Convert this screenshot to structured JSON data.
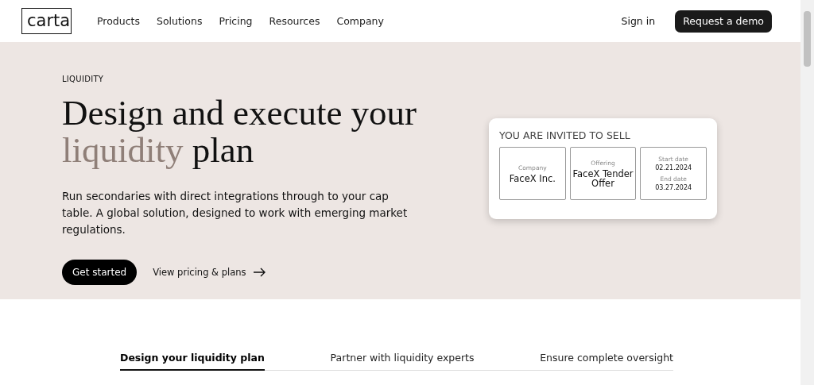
{
  "header": {
    "logo": "carta",
    "nav": [
      "Products",
      "Solutions",
      "Pricing",
      "Resources",
      "Company"
    ],
    "sign_in": "Sign in",
    "cta": "Request a demo"
  },
  "hero": {
    "eyebrow": "LIQUIDITY",
    "headline_before": "Design and execute your",
    "headline_accent": "liquidity",
    "headline_after": "plan",
    "body": "Run secondaries with direct integrations through to your cap table. A global solution, designed to work with emerging market regulations.",
    "primary": "Get started",
    "secondary": "View pricing & plans"
  },
  "card": {
    "title": "YOU ARE INVITED TO SELL",
    "company_label": "Company",
    "company": "FaceX Inc.",
    "offering_label": "Offering",
    "offering": "FaceX Tender Offer",
    "start_label": "Start date",
    "start": "02.21.2024",
    "end_label": "End date",
    "end": "03.27.2024"
  },
  "tabs": [
    {
      "label": "Design your liquidity plan",
      "selected": true
    },
    {
      "label": "Partner with liquidity experts",
      "selected": false
    },
    {
      "label": "Ensure complete oversight",
      "selected": false
    }
  ]
}
